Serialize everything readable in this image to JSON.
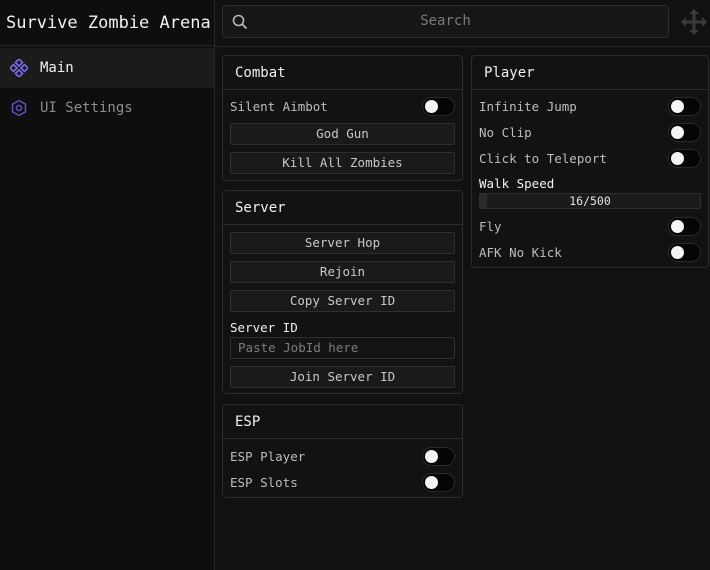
{
  "app": {
    "title": "Survive Zombie Arena"
  },
  "sidebar": {
    "items": [
      {
        "label": "Main",
        "icon": "diamond-cluster-icon",
        "active": true
      },
      {
        "label": "UI Settings",
        "icon": "gear-icon",
        "active": false
      }
    ]
  },
  "search": {
    "placeholder": "Search"
  },
  "colors": {
    "accent": "#7b6cf0",
    "background": "#111111"
  },
  "combat": {
    "title": "Combat",
    "silent_aimbot": {
      "label": "Silent Aimbot",
      "on": false
    },
    "god_gun": "God Gun",
    "kill_all": "Kill All Zombies"
  },
  "server": {
    "title": "Server",
    "server_hop": "Server Hop",
    "rejoin": "Rejoin",
    "copy_id": "Copy Server ID",
    "id_label": "Server ID",
    "id_placeholder": "Paste JobId here",
    "join_id": "Join Server ID"
  },
  "esp": {
    "title": "ESP",
    "player": {
      "label": "ESP Player",
      "on": false
    },
    "slots": {
      "label": "ESP Slots",
      "on": false
    }
  },
  "player": {
    "title": "Player",
    "infinite_jump": {
      "label": "Infinite Jump",
      "on": false
    },
    "no_clip": {
      "label": "No Clip",
      "on": false
    },
    "click_tp": {
      "label": "Click to Teleport",
      "on": false
    },
    "walk_speed": {
      "label": "Walk Speed",
      "value": 16,
      "max": 500,
      "display": "16/500"
    },
    "fly": {
      "label": "Fly",
      "on": false
    },
    "afk": {
      "label": "AFK No Kick",
      "on": false
    }
  }
}
